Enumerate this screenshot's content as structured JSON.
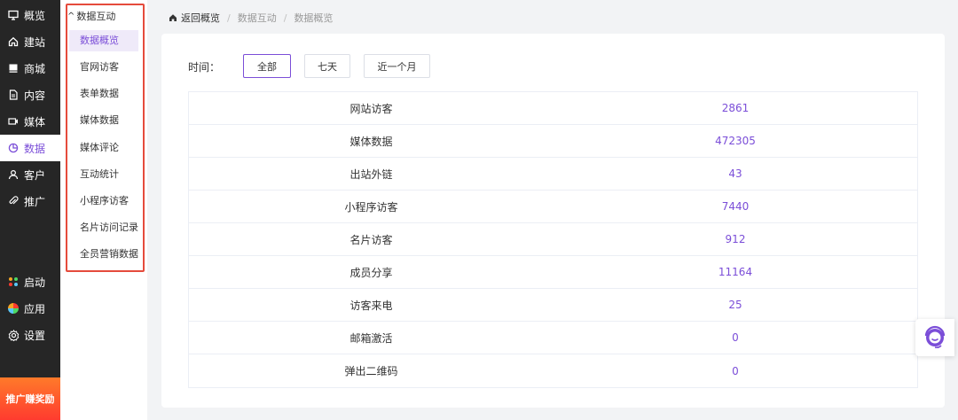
{
  "sidebar": {
    "items": [
      {
        "label": "概览",
        "icon": "dashboard-icon"
      },
      {
        "label": "建站",
        "icon": "home-icon"
      },
      {
        "label": "商城",
        "icon": "shop-icon"
      },
      {
        "label": "内容",
        "icon": "document-icon"
      },
      {
        "label": "媒体",
        "icon": "video-icon"
      },
      {
        "label": "数据",
        "icon": "pie-chart-icon"
      },
      {
        "label": "客户",
        "icon": "user-icon"
      },
      {
        "label": "推广",
        "icon": "paperclip-icon"
      }
    ],
    "bottom_items": [
      {
        "label": "启动",
        "icon": "launch-icon"
      },
      {
        "label": "应用",
        "icon": "apps-icon"
      },
      {
        "label": "设置",
        "icon": "gear-icon"
      }
    ],
    "promo_label": "推广赚奖励",
    "active_index": 5
  },
  "submenu": {
    "header": "数据互动",
    "items": [
      "数据概览",
      "官网访客",
      "表单数据",
      "媒体数据",
      "媒体评论",
      "互动统计",
      "小程序访客",
      "名片访问记录",
      "全员营销数据"
    ],
    "active_index": 0
  },
  "breadcrumb": {
    "home": "返回概览",
    "level1": "数据互动",
    "level2": "数据概览"
  },
  "filter": {
    "label": "时间：",
    "options": [
      "全部",
      "七天",
      "近一个月"
    ],
    "selected": "全部"
  },
  "stats": [
    {
      "name": "网站访客",
      "value": "2861"
    },
    {
      "name": "媒体数据",
      "value": "472305"
    },
    {
      "name": "出站外链",
      "value": "43"
    },
    {
      "name": "小程序访客",
      "value": "7440"
    },
    {
      "name": "名片访客",
      "value": "912"
    },
    {
      "name": "成员分享",
      "value": "11164"
    },
    {
      "name": "访客来电",
      "value": "25"
    },
    {
      "name": "邮箱激活",
      "value": "0"
    },
    {
      "name": "弹出二维码",
      "value": "0"
    }
  ],
  "colors": {
    "accent": "#7b4ed8",
    "sidebar_bg": "#262626",
    "highlight_border": "#e54b3c"
  }
}
